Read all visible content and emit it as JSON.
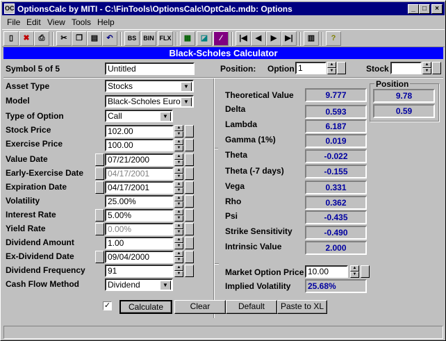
{
  "window": {
    "title": "OptionsCalc by MITI - C:\\FinTools\\OptionsCalc\\OptCalc.mdb: Options",
    "icon_text": "OC"
  },
  "menu": [
    "File",
    "Edit",
    "View",
    "Tools",
    "Help"
  ],
  "toolbar": {
    "icons": [
      "new-icon",
      "delete-icon",
      "print-icon",
      "cut-icon",
      "copy-icon",
      "paste-icon",
      "undo-icon",
      "buy-sell-icon",
      "bin-icon",
      "flx-icon",
      "calculator-icon",
      "chart-icon",
      "graph-icon",
      "first-record-icon",
      "prev-record-icon",
      "next-record-icon",
      "last-record-icon",
      "report-icon",
      "help-icon"
    ],
    "labels": {
      "bs": "BS",
      "bin": "BIN",
      "flx": "FLX",
      "help": "?"
    }
  },
  "banner": "Black-Scholes Calculator",
  "header": {
    "symbol_label": "Symbol  5 of 5",
    "symbol_value": "Untitled",
    "position_label": "Position:",
    "option_label": "Option",
    "option_value": "1",
    "stock_label": "Stock",
    "stock_value": ""
  },
  "inputs": {
    "asset_type": {
      "label": "Asset Type",
      "value": "Stocks"
    },
    "model": {
      "label": "Model",
      "value": "Black-Scholes Euro"
    },
    "type_of_option": {
      "label": "Type of Option",
      "value": "Call"
    },
    "stock_price": {
      "label": "Stock Price",
      "value": "102.00"
    },
    "exercise_price": {
      "label": "Exercise Price",
      "value": "100.00"
    },
    "value_date": {
      "label": "Value Date",
      "value": "07/21/2000"
    },
    "early_exercise_date": {
      "label": "Early-Exercise Date",
      "value": "04/17/2001"
    },
    "expiration_date": {
      "label": "Expiration Date",
      "value": "04/17/2001"
    },
    "volatility": {
      "label": "Volatility",
      "value": "25.00%"
    },
    "interest_rate": {
      "label": "Interest Rate",
      "value": "5.00%"
    },
    "yield_rate": {
      "label": "Yield Rate",
      "value": "0.00%"
    },
    "dividend_amount": {
      "label": "Dividend Amount",
      "value": "1.00"
    },
    "ex_dividend_date": {
      "label": "Ex-Dividend Date",
      "value": "09/04/2000"
    },
    "dividend_frequency": {
      "label": "Dividend Frequency",
      "value": "91"
    },
    "cash_flow_method": {
      "label": "Cash Flow Method",
      "value": "Dividend"
    }
  },
  "outputs": {
    "theoretical_value": {
      "label": "Theoretical Value",
      "value": "9.777"
    },
    "delta": {
      "label": "Delta",
      "value": "0.593"
    },
    "lambda": {
      "label": "Lambda",
      "value": "6.187"
    },
    "gamma": {
      "label": "Gamma (1%)",
      "value": "0.019"
    },
    "theta": {
      "label": "Theta",
      "value": "-0.022"
    },
    "theta7": {
      "label": "Theta (-7 days)",
      "value": "-0.155"
    },
    "vega": {
      "label": "Vega",
      "value": "0.331"
    },
    "rho": {
      "label": "Rho",
      "value": "0.362"
    },
    "psi": {
      "label": "Psi",
      "value": "-0.435"
    },
    "strike_sensitivity": {
      "label": "Strike Sensitivity",
      "value": "-0.490"
    },
    "intrinsic_value": {
      "label": "Intrinsic Value",
      "value": "2.000"
    }
  },
  "position_box": {
    "title": "Position",
    "value1": "9.78",
    "value2": "0.59"
  },
  "market": {
    "label": "Market Option Price",
    "value": "10.00",
    "iv_label": "Implied Volatility",
    "iv_value": "25.68%"
  },
  "buttons": {
    "calculate": "Calculate",
    "clear": "Clear",
    "default": "Default",
    "paste": "Paste to XL"
  },
  "checkbox": {
    "mark": "✓"
  },
  "colors": {
    "titlebar": "#000080",
    "banner": "#0000ff",
    "output_text": "#0000a0"
  }
}
